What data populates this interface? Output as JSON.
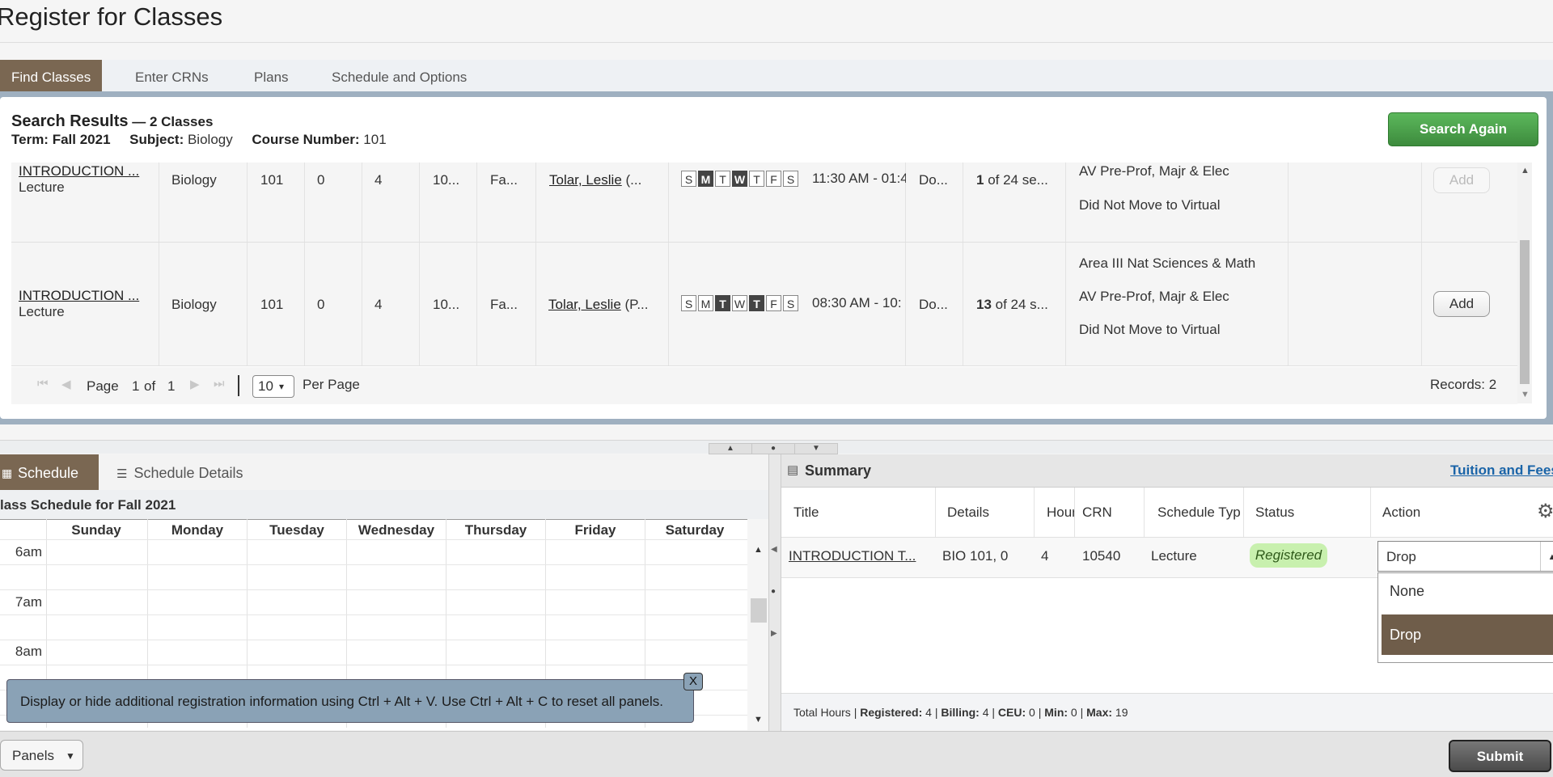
{
  "page": {
    "title": "Register for Classes"
  },
  "tabs": [
    "Find Classes",
    "Enter CRNs",
    "Plans",
    "Schedule and Options"
  ],
  "search_results": {
    "title": "Search Results",
    "count": " — 2 Classes",
    "term_label": "Term:",
    "term_value": "Fall 2021",
    "subject_label": "Subject:",
    "subject_value": "Biology",
    "course_label": "Course Number:",
    "course_value": "101",
    "search_again": "Search Again",
    "rows": [
      {
        "title": "INTRODUCTION ...",
        "type": "Lecture",
        "subject": "Biology",
        "course": "101",
        "section": "0",
        "hours": "4",
        "crn": "10...",
        "term": "Fa...",
        "instructor": "Tolar, Leslie",
        "instructor_suffix": " (...",
        "days": [
          "S",
          "M",
          "T",
          "W",
          "T",
          "F",
          "S"
        ],
        "days_on": [
          false,
          true,
          false,
          true,
          false,
          false,
          false
        ],
        "time": "11:30 AM - 01:4",
        "campus": "Do...",
        "seats_bold": "1",
        "seats_rest": " of 24 se...",
        "attributes": [
          "AV Pre-Prof, Majr & Elec",
          "Did Not Move to Virtual"
        ],
        "add": "Add",
        "add_enabled": false
      },
      {
        "title": "INTRODUCTION ...",
        "type": "Lecture",
        "subject": "Biology",
        "course": "101",
        "section": "0",
        "hours": "4",
        "crn": "10...",
        "term": "Fa...",
        "instructor": "Tolar, Leslie",
        "instructor_suffix": " (P...",
        "days": [
          "S",
          "M",
          "T",
          "W",
          "T",
          "F",
          "S"
        ],
        "days_on": [
          false,
          false,
          true,
          false,
          true,
          false,
          false
        ],
        "time": "08:30 AM - 10:",
        "campus": "Do...",
        "seats_bold": "13",
        "seats_rest": " of 24 s...",
        "attributes": [
          "Area III Nat Sciences & Math",
          "AV Pre-Prof, Majr & Elec",
          "Did Not Move to Virtual"
        ],
        "add": "Add",
        "add_enabled": true
      }
    ],
    "pager": {
      "page_label": "Page",
      "page_value": "1",
      "of_label": "of",
      "total_pages": "1",
      "per_page_value": "10",
      "per_page_label": "Per Page",
      "records": "Records: 2"
    }
  },
  "schedule": {
    "tab_schedule": "Schedule",
    "tab_details": "Schedule Details",
    "caption": "lass Schedule for Fall 2021",
    "days": [
      "Sunday",
      "Monday",
      "Tuesday",
      "Wednesday",
      "Thursday",
      "Friday",
      "Saturday"
    ],
    "times": [
      "6am",
      "7am",
      "8am"
    ],
    "tip": "Display or hide additional registration information using Ctrl + Alt + V. Use Ctrl + Alt + C to reset all panels.",
    "tip_close": "X"
  },
  "summary": {
    "title": "Summary",
    "tuition_link": "Tuition and Fees",
    "columns": [
      "Title",
      "Details",
      "Hour",
      "CRN",
      "Schedule Typ",
      "Status",
      "Action"
    ],
    "row": {
      "title": "INTRODUCTION T...",
      "details": "BIO 101, 0",
      "hours": "4",
      "crn": "10540",
      "schedule_type": "Lecture",
      "status": "Registered",
      "action": "Drop"
    },
    "action_options": [
      "None",
      "Drop"
    ],
    "totals": {
      "prefix": "Total Hours | ",
      "registered_label": "Registered:",
      "registered": " 4",
      "billing_label": "Billing:",
      "billing": " 4",
      "ceu_label": "CEU:",
      "ceu": " 0",
      "min_label": "Min:",
      "min": " 0",
      "max_label": "Max:",
      "max": " 19"
    }
  },
  "footer": {
    "panels": "Panels",
    "submit": "Submit"
  }
}
